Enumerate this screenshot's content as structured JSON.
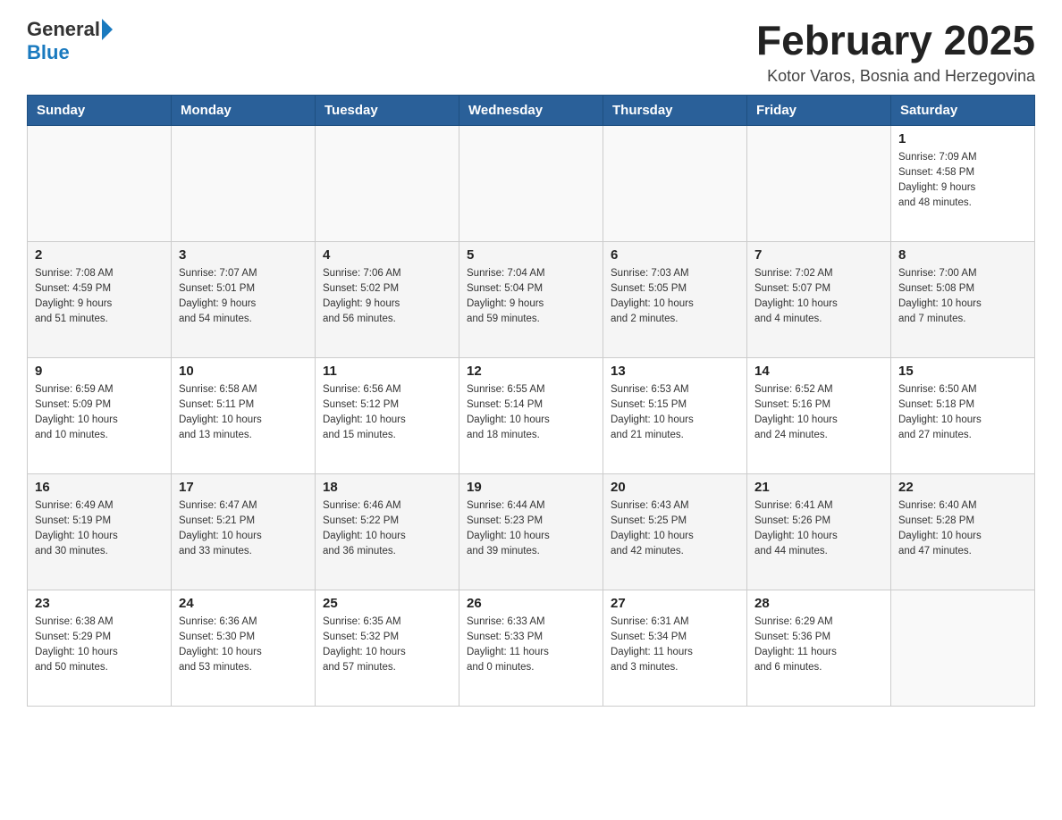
{
  "header": {
    "logo_general": "General",
    "logo_blue": "Blue",
    "title": "February 2025",
    "location": "Kotor Varos, Bosnia and Herzegovina"
  },
  "weekdays": [
    "Sunday",
    "Monday",
    "Tuesday",
    "Wednesday",
    "Thursday",
    "Friday",
    "Saturday"
  ],
  "weeks": [
    {
      "alt": false,
      "days": [
        {
          "num": "",
          "info": ""
        },
        {
          "num": "",
          "info": ""
        },
        {
          "num": "",
          "info": ""
        },
        {
          "num": "",
          "info": ""
        },
        {
          "num": "",
          "info": ""
        },
        {
          "num": "",
          "info": ""
        },
        {
          "num": "1",
          "info": "Sunrise: 7:09 AM\nSunset: 4:58 PM\nDaylight: 9 hours\nand 48 minutes."
        }
      ]
    },
    {
      "alt": true,
      "days": [
        {
          "num": "2",
          "info": "Sunrise: 7:08 AM\nSunset: 4:59 PM\nDaylight: 9 hours\nand 51 minutes."
        },
        {
          "num": "3",
          "info": "Sunrise: 7:07 AM\nSunset: 5:01 PM\nDaylight: 9 hours\nand 54 minutes."
        },
        {
          "num": "4",
          "info": "Sunrise: 7:06 AM\nSunset: 5:02 PM\nDaylight: 9 hours\nand 56 minutes."
        },
        {
          "num": "5",
          "info": "Sunrise: 7:04 AM\nSunset: 5:04 PM\nDaylight: 9 hours\nand 59 minutes."
        },
        {
          "num": "6",
          "info": "Sunrise: 7:03 AM\nSunset: 5:05 PM\nDaylight: 10 hours\nand 2 minutes."
        },
        {
          "num": "7",
          "info": "Sunrise: 7:02 AM\nSunset: 5:07 PM\nDaylight: 10 hours\nand 4 minutes."
        },
        {
          "num": "8",
          "info": "Sunrise: 7:00 AM\nSunset: 5:08 PM\nDaylight: 10 hours\nand 7 minutes."
        }
      ]
    },
    {
      "alt": false,
      "days": [
        {
          "num": "9",
          "info": "Sunrise: 6:59 AM\nSunset: 5:09 PM\nDaylight: 10 hours\nand 10 minutes."
        },
        {
          "num": "10",
          "info": "Sunrise: 6:58 AM\nSunset: 5:11 PM\nDaylight: 10 hours\nand 13 minutes."
        },
        {
          "num": "11",
          "info": "Sunrise: 6:56 AM\nSunset: 5:12 PM\nDaylight: 10 hours\nand 15 minutes."
        },
        {
          "num": "12",
          "info": "Sunrise: 6:55 AM\nSunset: 5:14 PM\nDaylight: 10 hours\nand 18 minutes."
        },
        {
          "num": "13",
          "info": "Sunrise: 6:53 AM\nSunset: 5:15 PM\nDaylight: 10 hours\nand 21 minutes."
        },
        {
          "num": "14",
          "info": "Sunrise: 6:52 AM\nSunset: 5:16 PM\nDaylight: 10 hours\nand 24 minutes."
        },
        {
          "num": "15",
          "info": "Sunrise: 6:50 AM\nSunset: 5:18 PM\nDaylight: 10 hours\nand 27 minutes."
        }
      ]
    },
    {
      "alt": true,
      "days": [
        {
          "num": "16",
          "info": "Sunrise: 6:49 AM\nSunset: 5:19 PM\nDaylight: 10 hours\nand 30 minutes."
        },
        {
          "num": "17",
          "info": "Sunrise: 6:47 AM\nSunset: 5:21 PM\nDaylight: 10 hours\nand 33 minutes."
        },
        {
          "num": "18",
          "info": "Sunrise: 6:46 AM\nSunset: 5:22 PM\nDaylight: 10 hours\nand 36 minutes."
        },
        {
          "num": "19",
          "info": "Sunrise: 6:44 AM\nSunset: 5:23 PM\nDaylight: 10 hours\nand 39 minutes."
        },
        {
          "num": "20",
          "info": "Sunrise: 6:43 AM\nSunset: 5:25 PM\nDaylight: 10 hours\nand 42 minutes."
        },
        {
          "num": "21",
          "info": "Sunrise: 6:41 AM\nSunset: 5:26 PM\nDaylight: 10 hours\nand 44 minutes."
        },
        {
          "num": "22",
          "info": "Sunrise: 6:40 AM\nSunset: 5:28 PM\nDaylight: 10 hours\nand 47 minutes."
        }
      ]
    },
    {
      "alt": false,
      "days": [
        {
          "num": "23",
          "info": "Sunrise: 6:38 AM\nSunset: 5:29 PM\nDaylight: 10 hours\nand 50 minutes."
        },
        {
          "num": "24",
          "info": "Sunrise: 6:36 AM\nSunset: 5:30 PM\nDaylight: 10 hours\nand 53 minutes."
        },
        {
          "num": "25",
          "info": "Sunrise: 6:35 AM\nSunset: 5:32 PM\nDaylight: 10 hours\nand 57 minutes."
        },
        {
          "num": "26",
          "info": "Sunrise: 6:33 AM\nSunset: 5:33 PM\nDaylight: 11 hours\nand 0 minutes."
        },
        {
          "num": "27",
          "info": "Sunrise: 6:31 AM\nSunset: 5:34 PM\nDaylight: 11 hours\nand 3 minutes."
        },
        {
          "num": "28",
          "info": "Sunrise: 6:29 AM\nSunset: 5:36 PM\nDaylight: 11 hours\nand 6 minutes."
        },
        {
          "num": "",
          "info": ""
        }
      ]
    }
  ]
}
